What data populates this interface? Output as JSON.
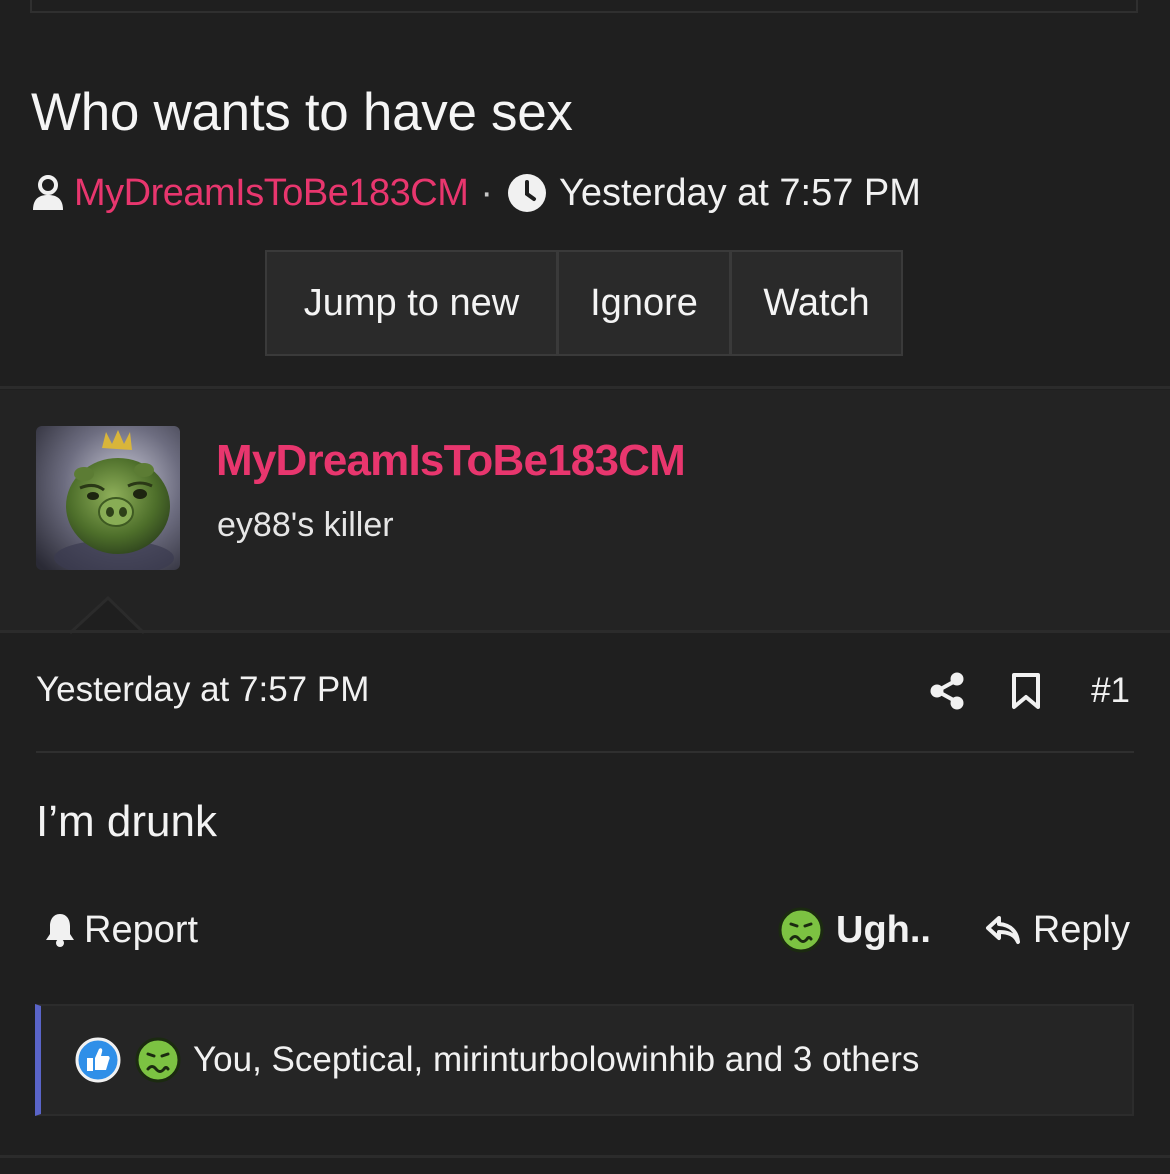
{
  "thread": {
    "title": "Who wants to have sex",
    "author": "MyDreamIsToBe183CM",
    "separator": "·",
    "time": "Yesterday at 7:57 PM"
  },
  "thread_buttons": {
    "jump_label": "Jump to new",
    "ignore_label": "Ignore",
    "watch_label": "Watch"
  },
  "post": {
    "username": "MyDreamIsToBe183CM",
    "user_title": "ey88's killer",
    "date": "Yesterday at 7:57 PM",
    "number": "#1",
    "body": "I’m drunk",
    "report_label": "Report",
    "reaction_label": "Ugh..",
    "reply_label": "Reply",
    "reactions_summary": "You, Sceptical, mirinturbolowinhib and 3 others"
  },
  "icons": {
    "author": "user-icon",
    "time": "clock-icon",
    "share": "share-icon",
    "bookmark": "bookmark-icon",
    "report": "bell-icon",
    "reaction": "nauseated-face-icon",
    "reply": "reply-arrow-icon",
    "like": "thumbs-up-icon"
  },
  "colors": {
    "background": "#1f1f1f",
    "username": "#e8366e",
    "reactions_accent": "#5a64c8",
    "like_badge": "#2f8fe8",
    "sick_face": "#7cc242"
  }
}
